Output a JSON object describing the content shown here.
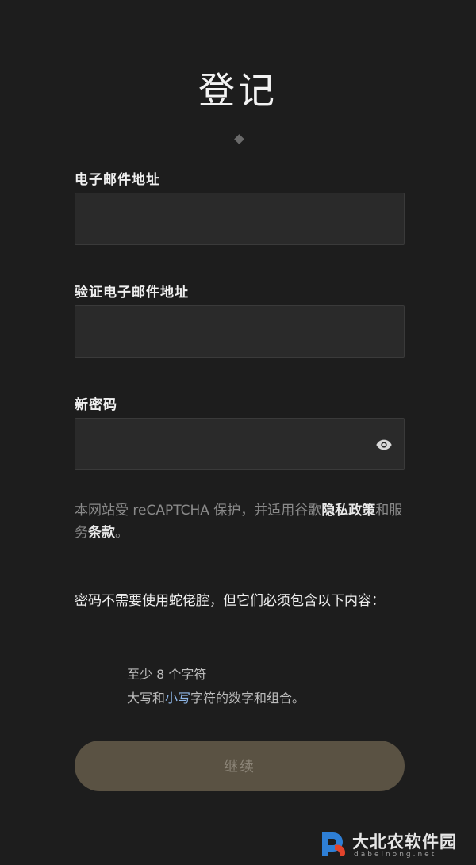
{
  "title": "登记",
  "form": {
    "email_label": "电子邮件地址",
    "email_value": "",
    "confirm_email_label": "验证电子邮件地址",
    "confirm_email_value": "",
    "password_label": "新密码",
    "password_value": ""
  },
  "recaptcha": {
    "text_before": "本网站受 reCAPTCHA 保护，并适用谷歌",
    "privacy_link": "隐私政策",
    "text_middle": "和服务",
    "terms_link": "条款",
    "text_end": "。"
  },
  "requirements": {
    "intro": "密码不需要使用蛇佬腔，但它们必须包含以下内容：",
    "item1": "至少 8 个字符",
    "item2_before": "大写和",
    "item2_highlight": "小写",
    "item2_after": "字符的数字和组合。"
  },
  "continue_label": "继续",
  "watermark": {
    "name": "大北农软件园",
    "sub": "dabeinong.net"
  },
  "colors": {
    "background": "#1d1d1d",
    "field": "#2a2a2a",
    "button": "#5a5243",
    "highlight": "#8fb7e8"
  }
}
